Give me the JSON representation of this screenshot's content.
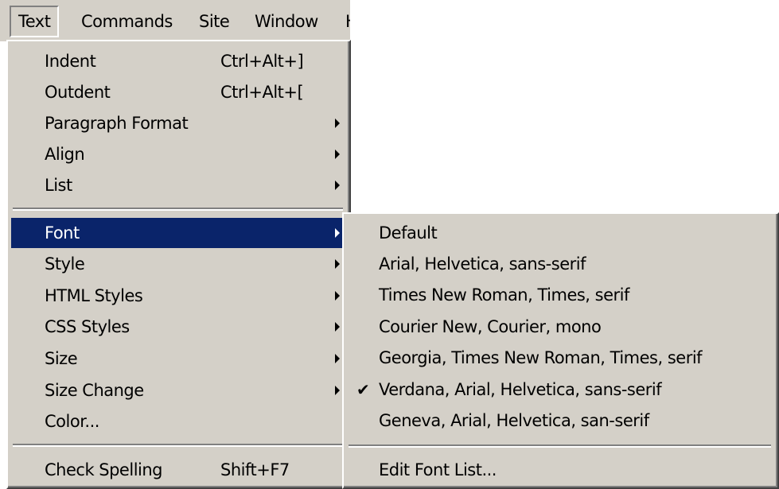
{
  "menubar": {
    "items": [
      {
        "label": "Text",
        "open": true
      },
      {
        "label": "Commands"
      },
      {
        "label": "Site"
      },
      {
        "label": "Window"
      },
      {
        "label": "H"
      }
    ]
  },
  "text_menu": {
    "items": [
      {
        "label": "Indent",
        "shortcut": "Ctrl+Alt+]"
      },
      {
        "label": "Outdent",
        "shortcut": "Ctrl+Alt+["
      },
      {
        "label": "Paragraph Format",
        "submenu": true
      },
      {
        "label": "Align",
        "submenu": true
      },
      {
        "label": "List",
        "submenu": true
      },
      {
        "label": "Font",
        "submenu": true,
        "highlighted": true
      },
      {
        "label": "Style",
        "submenu": true
      },
      {
        "label": "HTML Styles",
        "submenu": true
      },
      {
        "label": "CSS Styles",
        "submenu": true
      },
      {
        "label": "Size",
        "submenu": true
      },
      {
        "label": "Size Change",
        "submenu": true
      },
      {
        "label": "Color..."
      },
      {
        "label": "Check Spelling",
        "shortcut": "Shift+F7"
      }
    ]
  },
  "font_submenu": {
    "items": [
      {
        "label": "Default"
      },
      {
        "label": "Arial, Helvetica, sans-serif"
      },
      {
        "label": "Times New Roman, Times, serif"
      },
      {
        "label": "Courier New, Courier, mono"
      },
      {
        "label": "Georgia, Times New Roman, Times, serif"
      },
      {
        "label": "Verdana, Arial, Helvetica, sans-serif",
        "checked": true,
        "check_mark": "✔"
      },
      {
        "label": "Geneva, Arial, Helvetica, san-serif"
      },
      {
        "label": "Edit Font List..."
      }
    ]
  },
  "colors": {
    "menu_face": "#d4d0c8",
    "highlight": "#0a246a",
    "highlight_text": "#ffffff"
  }
}
